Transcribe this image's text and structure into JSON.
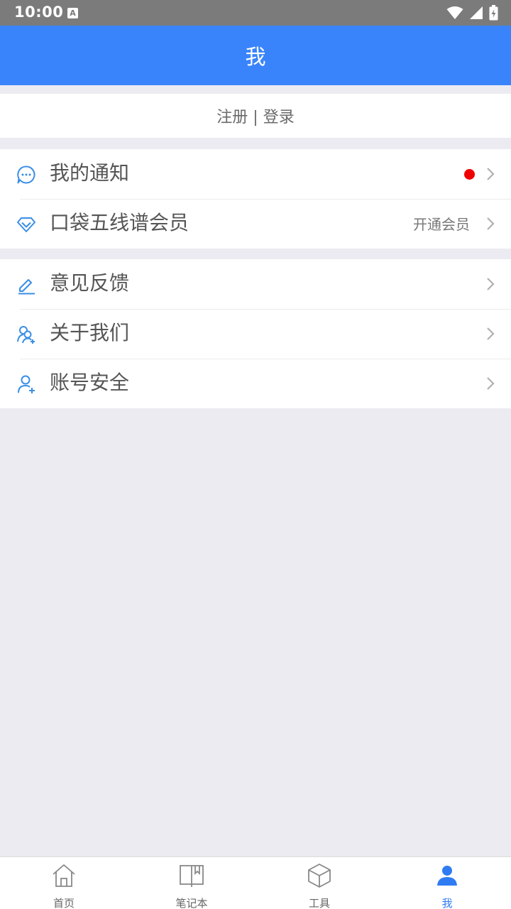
{
  "status_bar": {
    "time": "10:00",
    "notification_glyph": "A"
  },
  "header": {
    "title": "我"
  },
  "auth": {
    "text": "注册 | 登录"
  },
  "menu_group_1": [
    {
      "label": "我的通知",
      "icon": "message-dots-icon",
      "has_badge": true
    },
    {
      "label": "口袋五线谱会员",
      "icon": "diamond-icon",
      "extra": "开通会员"
    }
  ],
  "menu_group_2": [
    {
      "label": "意见反馈",
      "icon": "pencil-icon"
    },
    {
      "label": "关于我们",
      "icon": "users-icon"
    },
    {
      "label": "账号安全",
      "icon": "user-plus-icon"
    }
  ],
  "bottom_nav": [
    {
      "label": "首页",
      "icon": "home-icon"
    },
    {
      "label": "笔记本",
      "icon": "notebook-icon"
    },
    {
      "label": "工具",
      "icon": "box-icon"
    },
    {
      "label": "我",
      "icon": "person-icon",
      "active": true
    }
  ],
  "colors": {
    "primary": "#3a84fb",
    "active_nav": "#2f7cf2",
    "badge": "#f00000",
    "background": "#ebebf1"
  }
}
